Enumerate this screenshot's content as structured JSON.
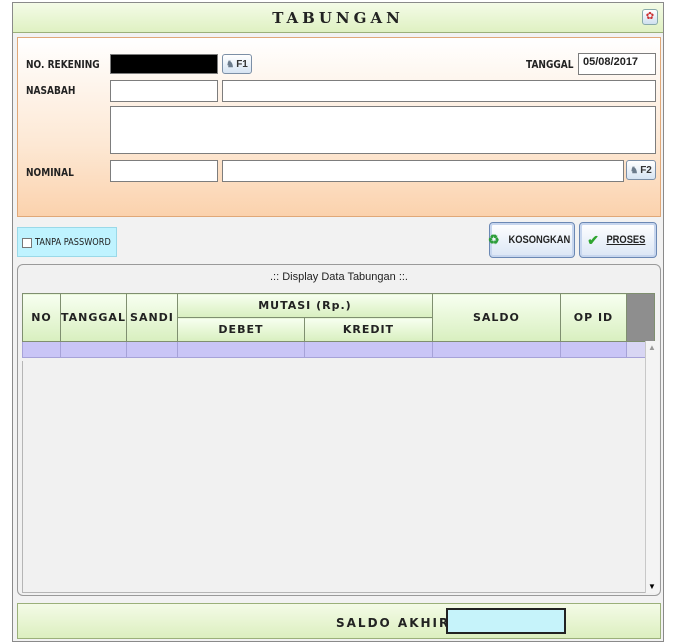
{
  "window": {
    "title": "TABUNGAN",
    "title_button_icon": "palette-icon"
  },
  "form": {
    "no_rekening_label": "NO. REKENING",
    "no_rekening_value": "",
    "f1_button": "F1",
    "tanggal_label": "TANGGAL",
    "tanggal_value": "05/08/2017",
    "nasabah_label": "NASABAH",
    "nasabah_code": "",
    "nasabah_name": "",
    "address": "",
    "nominal_label": "NOMINAL",
    "nominal_value": "",
    "nominal_text": "",
    "f2_button": "F2"
  },
  "options": {
    "tanpa_password_label": "TANPA PASSWORD",
    "tanpa_password_checked": false
  },
  "actions": {
    "kosongkan_label": "KOSONGKAN",
    "proses_label": "PROSES"
  },
  "grid": {
    "title": ".:: Display Data Tabungan ::.",
    "headers": {
      "no": "NO",
      "tanggal": "TANGGAL",
      "sandi": "SANDI",
      "mutasi": "MUTASI (Rp.)",
      "debet": "DEBET",
      "kredit": "KREDIT",
      "saldo": "SALDO",
      "op_id": "OP ID"
    },
    "rows": []
  },
  "footer": {
    "saldo_akhir_label": "SALDO AKHIR",
    "saldo_akhir_value": ""
  },
  "colors": {
    "title_bar": "#dff1c2",
    "form_bg": "#fbd2ad",
    "grid_row": "#c9c5f6",
    "password_bg": "#bff3ff",
    "saldo_box": "#c6f3fa"
  }
}
